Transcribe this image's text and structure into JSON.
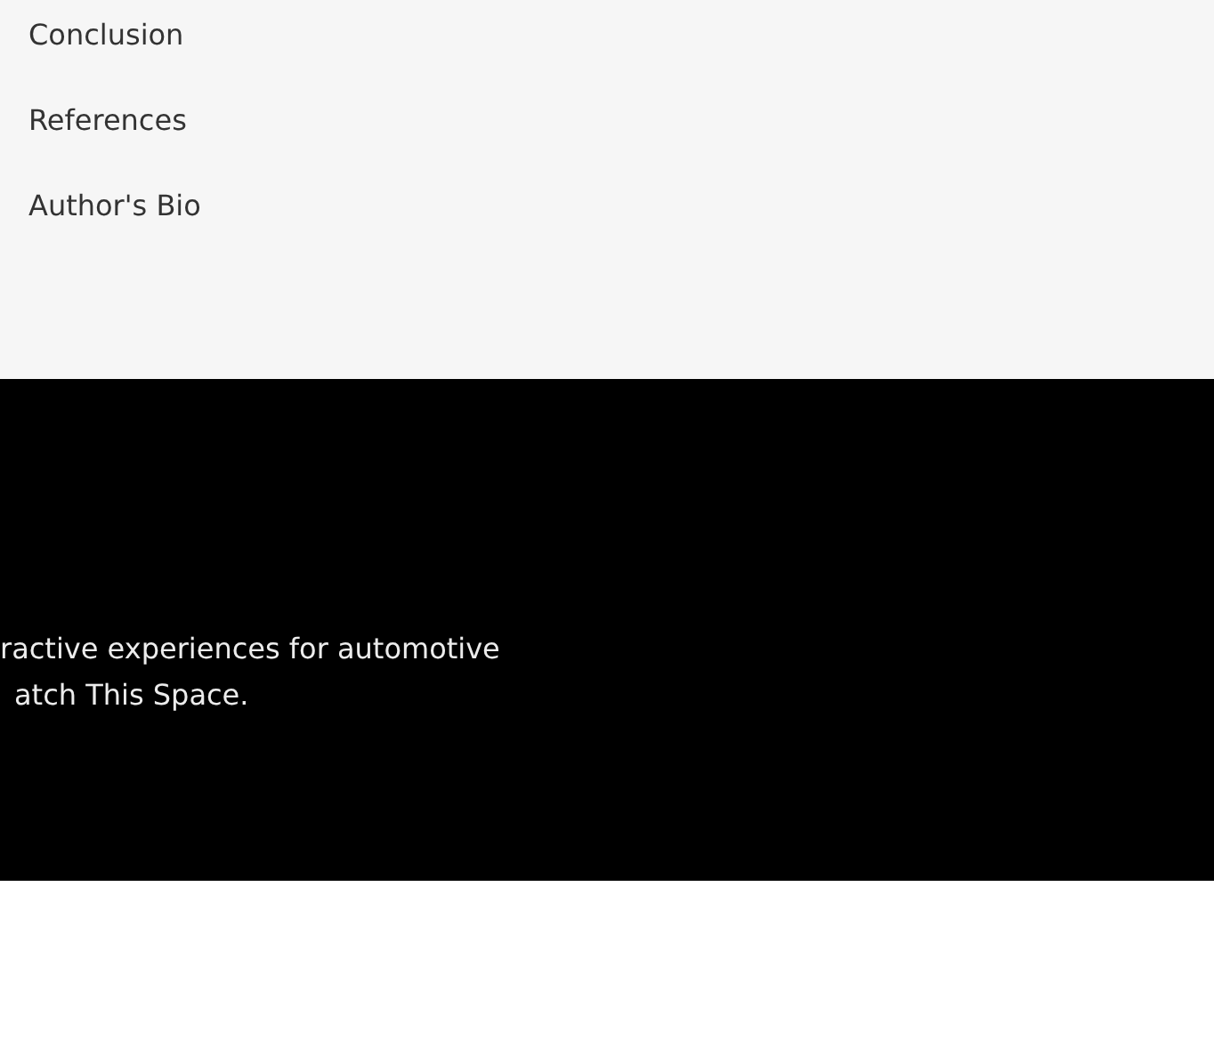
{
  "toc": {
    "links": [
      {
        "label": "Conclusion"
      },
      {
        "label": "References"
      },
      {
        "label": "Author's Bio"
      }
    ]
  },
  "footer": {
    "lines": [
      "ractive experiences for automotive",
      "atch This Space."
    ]
  }
}
